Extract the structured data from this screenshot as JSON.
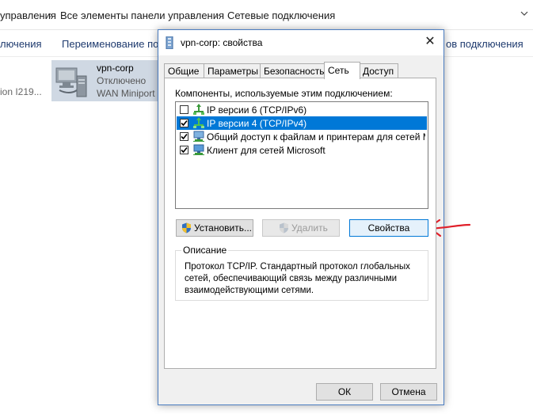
{
  "address_bar": {
    "crumbs": [
      "управления",
      "Все элементы панели управления",
      "Сетевые подключения"
    ]
  },
  "command_bar": {
    "items": [
      "лючения",
      "Переименование подк",
      "ов подключения"
    ]
  },
  "connection_tile": {
    "name": "vpn-corp",
    "status": "Отключено",
    "device": "WAN Miniport",
    "left_fragment": "ion I219..."
  },
  "dialog": {
    "title": "vpn-corp: свойства",
    "close_label": "✕",
    "tabs": [
      "Общие",
      "Параметры",
      "Безопасность",
      "Сеть",
      "Доступ"
    ],
    "active_tab": "Сеть",
    "components_label": "Компоненты, используемые этим подключением:",
    "components": [
      {
        "label": "IP версии 6 (TCP/IPv6)",
        "checked": false,
        "selected": false,
        "icon": "network-protocol-icon"
      },
      {
        "label": "IP версии 4 (TCP/IPv4)",
        "checked": true,
        "selected": true,
        "icon": "network-protocol-icon"
      },
      {
        "label": "Общий доступ к файлам и принтерам для сетей Micr...",
        "checked": true,
        "selected": false,
        "icon": "network-service-icon"
      },
      {
        "label": "Клиент для сетей Microsoft",
        "checked": true,
        "selected": false,
        "icon": "network-client-icon"
      }
    ],
    "buttons": {
      "install": "Установить...",
      "remove": "Удалить",
      "properties": "Свойства"
    },
    "description_title": "Описание",
    "description_text": "Протокол TCP/IP. Стандартный протокол глобальных сетей, обеспечивающий связь между различными взаимодействующими сетями.",
    "ok_label": "ОК",
    "cancel_label": "Отмена"
  },
  "colors": {
    "selection": "#0078d7",
    "annotation_arrow": "#e0202a",
    "dialog_border": "#4a7cc0"
  }
}
